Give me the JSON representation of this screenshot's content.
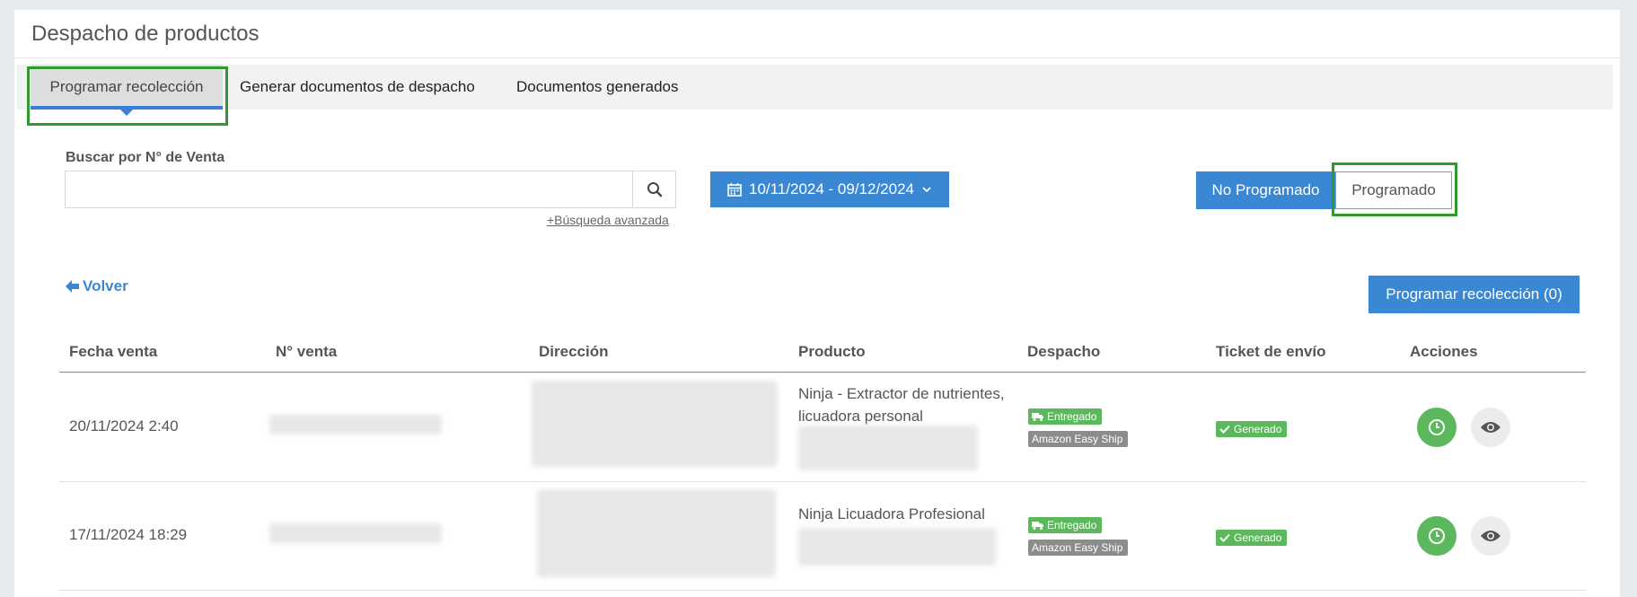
{
  "page": {
    "title": "Despacho de productos"
  },
  "tabs": [
    {
      "label": "Programar recolección"
    },
    {
      "label": "Generar documentos de despacho"
    },
    {
      "label": "Documentos generados"
    }
  ],
  "search": {
    "label": "Buscar por N° de Venta",
    "value": "",
    "placeholder": "",
    "advanced_link": "+Búsqueda avanzada"
  },
  "date_range": {
    "label": "10/11/2024 - 09/12/2024"
  },
  "status_toggle": {
    "no_programado": "No Programado",
    "programado": "Programado"
  },
  "back_link": "Volver",
  "schedule_button": "Programar recolección (0)",
  "table": {
    "headers": [
      "Fecha venta",
      "N° venta",
      "Dirección",
      "Producto",
      "Despacho",
      "Ticket de envío",
      "Acciones"
    ],
    "rows": [
      {
        "fecha": "20/11/2024 2:40",
        "producto": "Ninja - Extractor de nutrientes, licuadora personal",
        "despacho_estado": "Entregado",
        "despacho_servicio": "Amazon Easy Ship",
        "ticket": "Generado"
      },
      {
        "fecha": "17/11/2024 18:29",
        "producto": "Ninja Licuadora Profesional",
        "despacho_estado": "Entregado",
        "despacho_servicio": "Amazon Easy Ship",
        "ticket": "Generado"
      }
    ]
  },
  "colors": {
    "primary": "#3a87d3",
    "success": "#5cb85c",
    "highlight": "#2f9a2f",
    "muted": "#8c8c8c"
  },
  "icons": [
    "search-icon",
    "calendar-icon",
    "chevron-down-icon",
    "arrow-left-icon",
    "truck-icon",
    "check-icon",
    "clock-icon",
    "eye-icon"
  ]
}
